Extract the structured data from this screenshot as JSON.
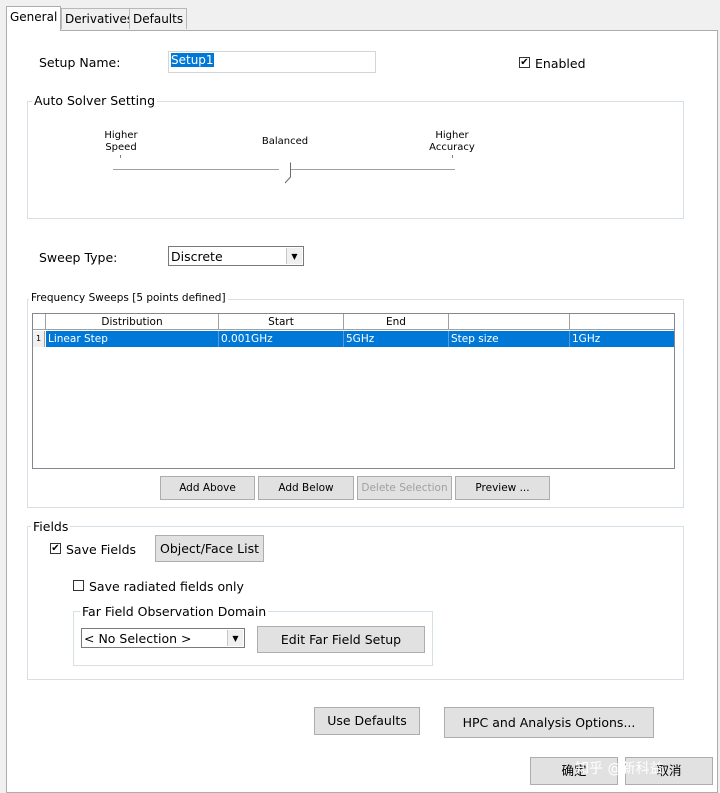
{
  "tabs": [
    "General",
    "Derivatives",
    "Defaults"
  ],
  "setup": {
    "name_label": "Setup Name:",
    "name_value": "Setup1",
    "enabled_label": "Enabled",
    "enabled": true
  },
  "auto_solver": {
    "title": "Auto Solver Setting",
    "left_label_1": "Higher",
    "left_label_2": "Speed",
    "mid_label": "Balanced",
    "right_label_1": "Higher",
    "right_label_2": "Accuracy"
  },
  "sweep": {
    "label": "Sweep Type:",
    "value": "Discrete"
  },
  "freq_sweeps": {
    "title": "Frequency Sweeps [5 points defined]",
    "columns": [
      "Distribution",
      "Start",
      "End",
      "",
      ""
    ],
    "rows": [
      {
        "num": "1",
        "cells": [
          "Linear Step",
          "0.001GHz",
          "5GHz",
          "Step size",
          "1GHz"
        ]
      }
    ],
    "buttons": {
      "add_above": "Add Above",
      "add_below": "Add Below",
      "delete_selection": "Delete Selection",
      "preview": "Preview ..."
    }
  },
  "fields": {
    "title": "Fields",
    "save_fields_label": "Save Fields",
    "save_fields": true,
    "object_face_list": "Object/Face List",
    "save_radiated_label": "Save radiated fields only",
    "save_radiated": false,
    "far_field_title": "Far Field Observation Domain",
    "far_field_value": "< No Selection >",
    "edit_far_field": "Edit Far Field Setup"
  },
  "bottom": {
    "use_defaults": "Use Defaults",
    "hpc_options": "HPC and Analysis Options...",
    "ok": "确定",
    "cancel": "取消"
  },
  "watermark": "知乎 @新科益",
  "colors": {
    "selection": "#0078d7"
  }
}
